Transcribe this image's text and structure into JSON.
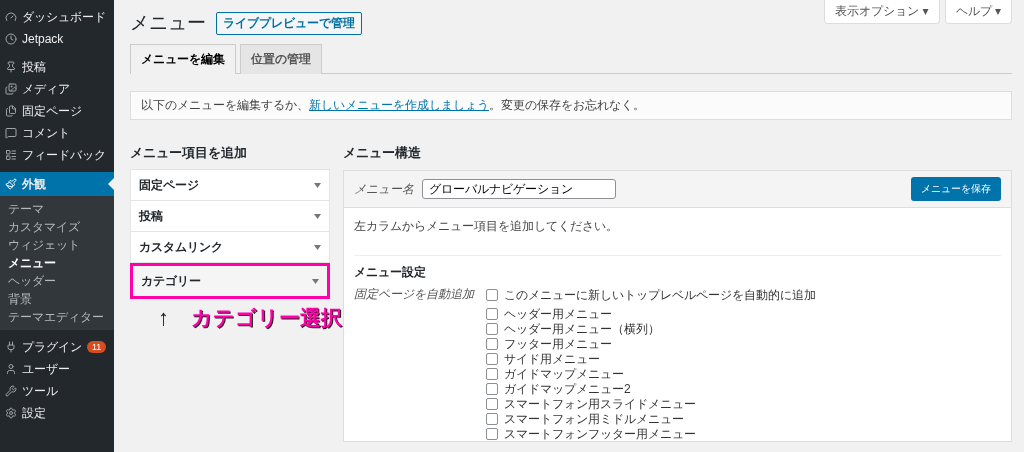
{
  "sidebar": {
    "items": [
      {
        "label": "ダッシュボード",
        "selected": false
      },
      {
        "label": "Jetpack",
        "selected": false
      },
      {
        "label": "投稿",
        "selected": false
      },
      {
        "label": "メディア",
        "selected": false
      },
      {
        "label": "固定ページ",
        "selected": false
      },
      {
        "label": "コメント",
        "selected": false
      },
      {
        "label": "フィードバック",
        "selected": false
      },
      {
        "label": "外観",
        "selected": true,
        "children": [
          {
            "label": "テーマ",
            "selected": false
          },
          {
            "label": "カスタマイズ",
            "selected": false
          },
          {
            "label": "ウィジェット",
            "selected": false
          },
          {
            "label": "メニュー",
            "selected": true
          },
          {
            "label": "ヘッダー",
            "selected": false
          },
          {
            "label": "背景",
            "selected": false
          },
          {
            "label": "テーマエディター",
            "selected": false
          }
        ]
      },
      {
        "label": "プラグイン",
        "selected": false,
        "badge": "11"
      },
      {
        "label": "ユーザー",
        "selected": false
      },
      {
        "label": "ツール",
        "selected": false
      },
      {
        "label": "設定",
        "selected": false
      }
    ]
  },
  "top_buttons": [
    "表示オプション ▾",
    "ヘルプ ▾"
  ],
  "page": {
    "title": "メニュー",
    "action": "ライブプレビューで管理"
  },
  "tabs": [
    {
      "label": "メニューを編集",
      "selected": true
    },
    {
      "label": "位置の管理",
      "selected": false
    }
  ],
  "notice": {
    "before": "以下のメニューを編集するか、",
    "link": "新しいメニューを作成しましょう",
    "after": "。変更の保存をお忘れなく。"
  },
  "add_items": {
    "heading": "メニュー項目を追加",
    "sections": [
      {
        "label": "固定ページ",
        "highlighted": false
      },
      {
        "label": "投稿",
        "highlighted": false
      },
      {
        "label": "カスタムリンク",
        "highlighted": false
      },
      {
        "label": "カテゴリー",
        "highlighted": true
      }
    ]
  },
  "annotation": {
    "arrow": "↑",
    "text": "カテゴリー選択"
  },
  "structure": {
    "heading": "メニュー構造",
    "name_label": "メニュー名",
    "name_value": "グローバルナビゲーション",
    "save": "メニューを保存",
    "instruction": "左カラムからメニュー項目を追加してください。",
    "settings_heading": "メニュー設定",
    "auto_add_label": "固定ページを自動追加",
    "auto_add": {
      "label": "このメニューに新しいトップレベルページを自動的に追加",
      "checked": false
    },
    "locations": [
      {
        "label": "ヘッダー用メニュー",
        "checked": false
      },
      {
        "label": "ヘッダー用メニュー（横列）",
        "checked": false
      },
      {
        "label": "フッター用メニュー",
        "checked": false
      },
      {
        "label": "サイド用メニュー",
        "checked": false
      },
      {
        "label": "ガイドマップメニュー",
        "checked": false
      },
      {
        "label": "ガイドマップメニュー2",
        "checked": false
      },
      {
        "label": "スマートフォン用スライドメニュー",
        "checked": false
      },
      {
        "label": "スマートフォン用ミドルメニュー",
        "checked": false
      },
      {
        "label": "スマートフォンフッター用メニュー",
        "checked": false
      }
    ]
  }
}
